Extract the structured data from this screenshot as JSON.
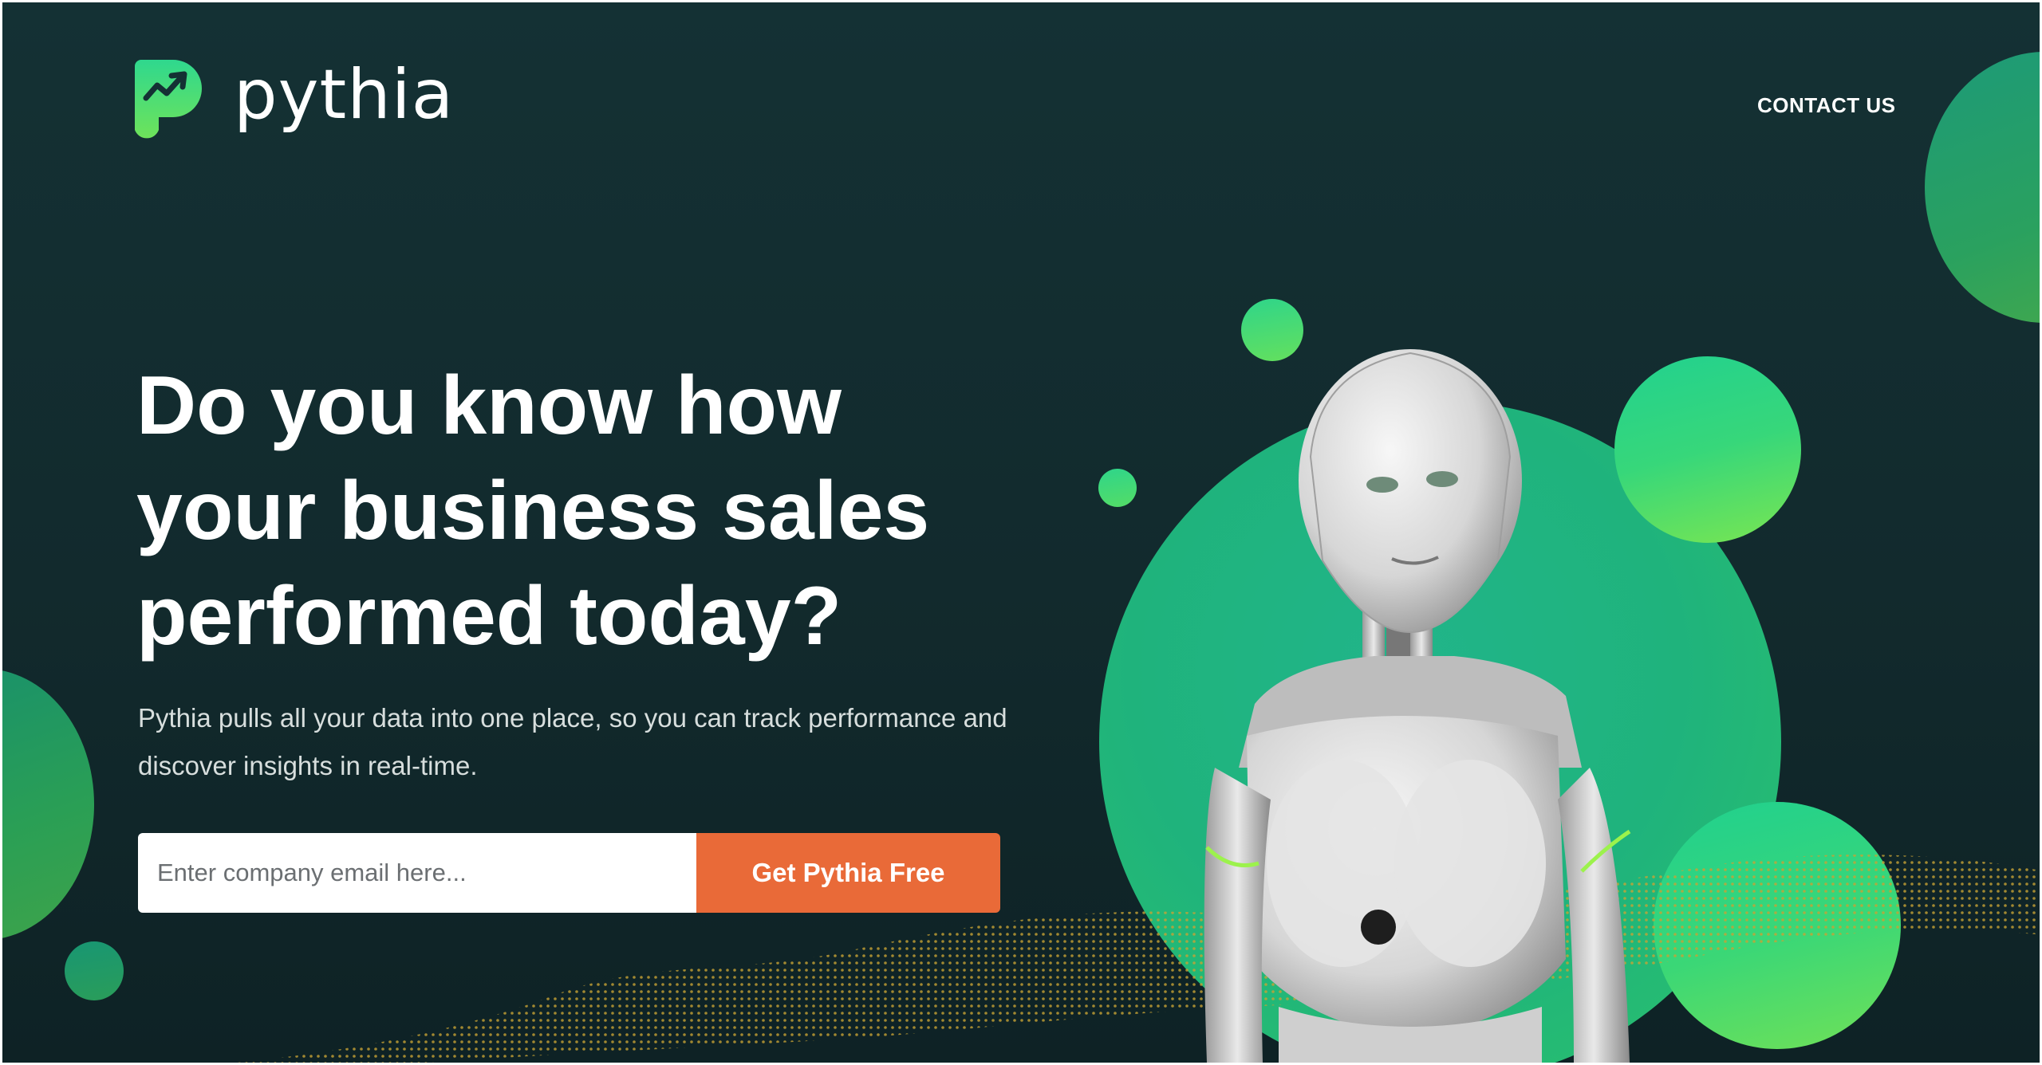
{
  "brand": {
    "name": "pythia",
    "colors": {
      "accent_green": "#2ed47a",
      "cta_orange": "#e96a38",
      "background": "#132e31"
    }
  },
  "nav": {
    "contact_label": "CONTACT US"
  },
  "hero": {
    "headline_lines": [
      "Do you know how",
      "your business sales",
      "performed today?"
    ],
    "subtext_lines": [
      "Pythia pulls all your data into one place, so you can track performance and",
      "discover insights in real-time."
    ]
  },
  "form": {
    "email_placeholder": "Enter company email here...",
    "email_value": "",
    "submit_label": "Get Pythia Free"
  },
  "illustration": {
    "icon": "robot-illustration"
  }
}
